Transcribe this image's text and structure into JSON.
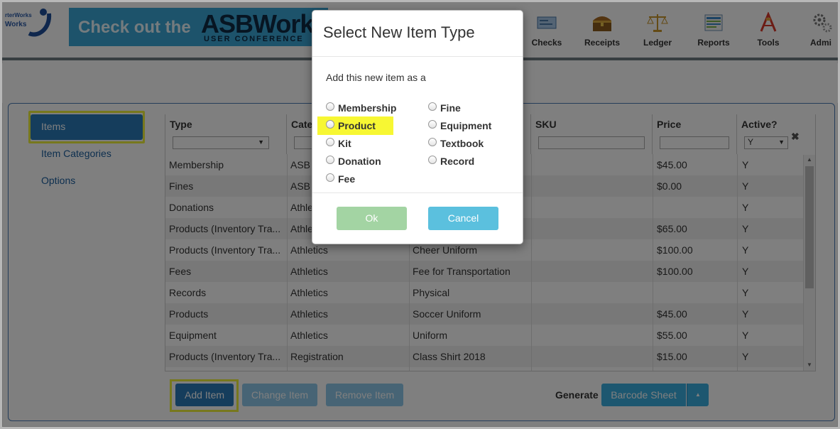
{
  "header": {
    "logo_line1": "rterWorks",
    "logo_line2": "Works",
    "banner_text1": "Check out the",
    "banner_text2": "ASBWorks",
    "banner_text3": "USER CONFERENCE",
    "nav": [
      {
        "label": "Checks",
        "icon": "checks-icon"
      },
      {
        "label": "Receipts",
        "icon": "treasure-chest-icon"
      },
      {
        "label": "Ledger",
        "icon": "scales-icon"
      },
      {
        "label": "Reports",
        "icon": "reports-icon"
      },
      {
        "label": "Tools",
        "icon": "tools-icon"
      },
      {
        "label": "Admi",
        "icon": "gears-icon"
      }
    ]
  },
  "sidebar": {
    "items": [
      {
        "label": "Items",
        "active": true
      },
      {
        "label": "Item Categories",
        "active": false
      },
      {
        "label": "Options",
        "active": false
      }
    ]
  },
  "table": {
    "headers": [
      "Type",
      "Cate",
      "",
      "SKU",
      "Price",
      "Active?"
    ],
    "type_filter_value": "",
    "active_filter_value": "Y",
    "clear_filter_icon": "close-icon",
    "rows": [
      {
        "type": "Membership",
        "category": "ASB",
        "name": "",
        "sku": "",
        "price": "$45.00",
        "active": "Y"
      },
      {
        "type": "Fines",
        "category": "ASB",
        "name": "",
        "sku": "",
        "price": "$0.00",
        "active": "Y"
      },
      {
        "type": "Donations",
        "category": "Athle",
        "name": "",
        "sku": "",
        "price": "",
        "active": "Y"
      },
      {
        "type": "Products (Inventory Tra...",
        "category": "Athle",
        "name": "",
        "sku": "",
        "price": "$65.00",
        "active": "Y"
      },
      {
        "type": "Products (Inventory Tra...",
        "category": "Athletics",
        "name": "Cheer Uniform",
        "sku": "",
        "price": "$100.00",
        "active": "Y"
      },
      {
        "type": "Fees",
        "category": "Athletics",
        "name": "Fee for Transportation",
        "sku": "",
        "price": "$100.00",
        "active": "Y"
      },
      {
        "type": "Records",
        "category": "Athletics",
        "name": "Physical",
        "sku": "",
        "price": "",
        "active": "Y"
      },
      {
        "type": "Products",
        "category": "Athletics",
        "name": "Soccer Uniform",
        "sku": "",
        "price": "$45.00",
        "active": "Y"
      },
      {
        "type": "Equipment",
        "category": "Athletics",
        "name": "Uniform",
        "sku": "",
        "price": "$55.00",
        "active": "Y"
      },
      {
        "type": "Products (Inventory Tra...",
        "category": "Registration",
        "name": "Class Shirt 2018",
        "sku": "",
        "price": "$15.00",
        "active": "Y"
      }
    ]
  },
  "actions": {
    "add_label": "Add Item",
    "change_label": "Change Item",
    "remove_label": "Remove Item",
    "generate_label": "Generate",
    "barcode_label": "Barcode Sheet"
  },
  "modal": {
    "title": "Select New Item Type",
    "subtitle": "Add this new item as a",
    "options_left": [
      "Membership",
      "Product",
      "Kit",
      "Donation",
      "Fee"
    ],
    "options_right": [
      "Fine",
      "Equipment",
      "Textbook",
      "Record"
    ],
    "ok_label": "Ok",
    "cancel_label": "Cancel"
  },
  "colors": {
    "highlight": "#f7f733",
    "primary": "#2b7ab8",
    "ok": "#5cb85c",
    "cancel": "#5bc0de"
  }
}
